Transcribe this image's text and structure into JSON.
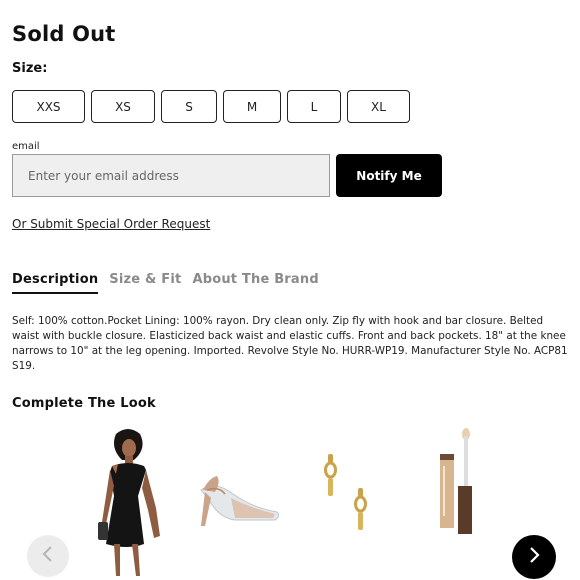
{
  "product": {
    "status_title": "Sold Out",
    "size_label": "Size:",
    "sizes": [
      "XXS",
      "XS",
      "S",
      "M",
      "L",
      "XL"
    ]
  },
  "notify": {
    "email_label": "email",
    "email_placeholder": "Enter your email address",
    "email_value": "",
    "button_label": "Notify Me"
  },
  "special_order_link": "Or Submit Special Order Request",
  "tabs": [
    {
      "label": "Description",
      "active": true
    },
    {
      "label": "Size & Fit",
      "active": false
    },
    {
      "label": "About The Brand",
      "active": false
    }
  ],
  "description": "Self: 100% cotton.Pocket Lining: 100% rayon. Dry clean only. Zip fly with hook and bar closure. Belted waist with buckle closure. Elasticized back waist and elastic cuffs. Front and back pockets. 18\" at the knee narrows to 10\" at the leg opening. Imported. Revolve Style No. HURR-WP19. Manufacturer Style No. ACP81 S19.",
  "complete_the_look": {
    "title": "Complete The Look",
    "items": [
      {
        "icon": "one-shoulder-dress-image"
      },
      {
        "icon": "clear-slingback-heel-image"
      },
      {
        "icon": "gold-drop-earrings-image"
      },
      {
        "icon": "concealer-tube-image"
      }
    ],
    "prev_icon": "chevron-left-icon",
    "next_icon": "chevron-right-icon"
  },
  "colors": {
    "primary": "#000000",
    "input_bg": "#efefef",
    "muted_tab": "#8a8a8a"
  }
}
